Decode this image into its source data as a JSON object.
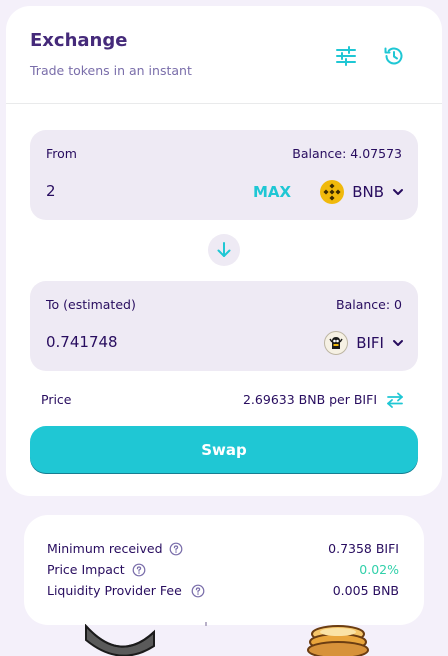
{
  "header": {
    "title": "Exchange",
    "subtitle": "Trade tokens in an instant",
    "settings_icon": "sliders-icon",
    "history_icon": "history-icon"
  },
  "from": {
    "label": "From",
    "balance": "Balance: 4.07573",
    "amount": "2",
    "max_label": "MAX",
    "token": "BNB",
    "token_icon": "bnb-logo"
  },
  "switch_icon": "arrow-down-icon",
  "to": {
    "label": "To (estimated)",
    "balance": "Balance: 0",
    "amount": "0.741748",
    "token": "BIFI",
    "token_icon": "bifi-logo"
  },
  "price": {
    "label": "Price",
    "value": "2.69633 BNB per BIFI",
    "invert_icon": "swap-arrows-icon"
  },
  "swap_button_label": "Swap",
  "details": {
    "rows": [
      {
        "label": "Minimum received",
        "value": "0.7358 BIFI"
      },
      {
        "label": "Price Impact",
        "value": "0.02%"
      },
      {
        "label": "Liquidity Provider Fee",
        "value": "0.005 BNB"
      }
    ]
  },
  "colors": {
    "primary": "#1fc7d4",
    "title": "#452a7a",
    "text": "#280d5f",
    "input_bg": "#eeeaf4",
    "success": "#31d0aa",
    "bnb": "#f0b90b"
  }
}
